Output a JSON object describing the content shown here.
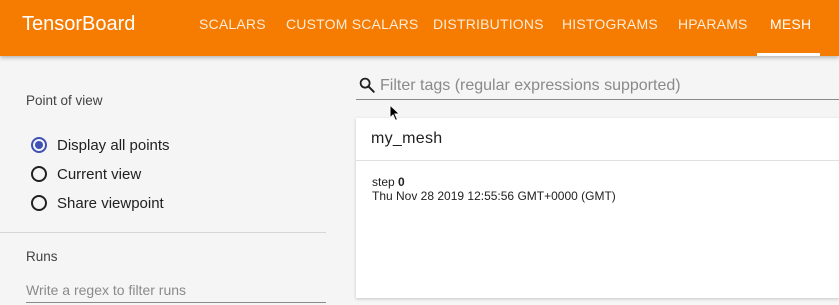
{
  "app": {
    "title": "TensorBoard"
  },
  "nav": {
    "tabs": [
      {
        "label": "SCALARS"
      },
      {
        "label": "CUSTOM SCALARS"
      },
      {
        "label": "DISTRIBUTIONS"
      },
      {
        "label": "HISTOGRAMS"
      },
      {
        "label": "HPARAMS"
      },
      {
        "label": "MESH",
        "active": true
      }
    ],
    "active_color": "#ffffff",
    "bar_color": "#f57c00"
  },
  "sidebar": {
    "point_of_view": {
      "title": "Point of view",
      "options": [
        {
          "label": "Display all points",
          "checked": true
        },
        {
          "label": "Current view",
          "checked": false
        },
        {
          "label": "Share viewpoint",
          "checked": false
        }
      ]
    },
    "runs": {
      "title": "Runs",
      "filter_placeholder": "Write a regex to filter runs"
    }
  },
  "main": {
    "search": {
      "placeholder": "Filter tags (regular expressions supported)",
      "value": "",
      "icon": "search-icon"
    },
    "card": {
      "title": "my_mesh",
      "step_label": "step",
      "step_value": "0",
      "timestamp": "Thu Nov 28 2019 12:55:56 GMT+0000 (GMT)"
    }
  }
}
